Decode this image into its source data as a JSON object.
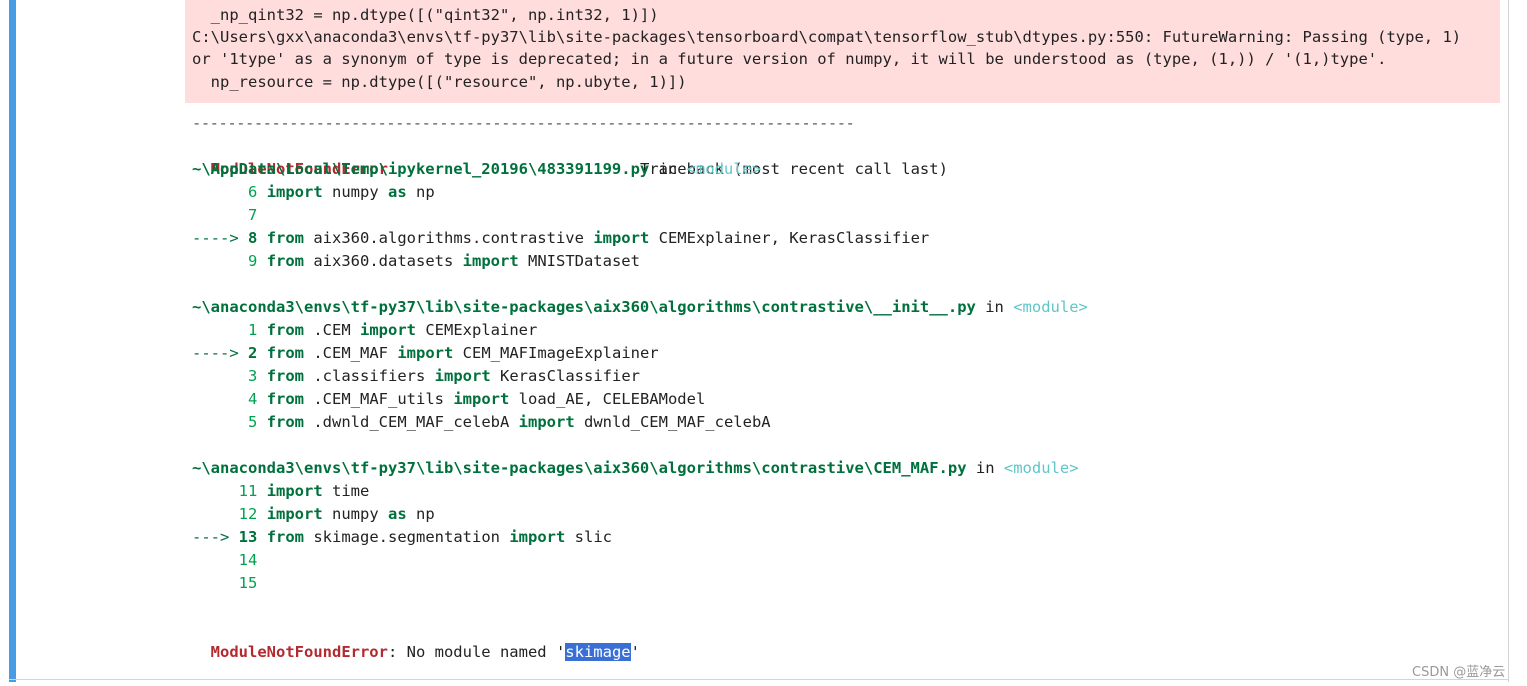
{
  "warning": {
    "lines": [
      "  _np_qint32 = np.dtype([(\"qint32\", np.int32, 1)])",
      "C:\\Users\\gxx\\anaconda3\\envs\\tf-py37\\lib\\site-packages\\tensorboard\\compat\\tensorflow_stub\\dtypes.py:550: FutureWarning: Passing (type, 1)",
      "or '1type' as a synonym of type is deprecated; in a future version of numpy, it will be understood as (type, (1,)) / '(1,)type'.",
      "  np_resource = np.dtype([(\"resource\", np.ubyte, 1)])"
    ]
  },
  "traceback": {
    "separator": "---------------------------------------------------------------------------",
    "error_name": "ModuleNotFoundError",
    "header_gap": "                           ",
    "header_text": "Traceback (most recent call last)",
    "in_text": " in ",
    "module_text": "<module>",
    "frames": [
      {
        "path": "~\\AppData\\Local\\Temp\\ipykernel_20196\\483391199.py",
        "lines": [
          {
            "prefix": "      ",
            "no": "6",
            "code": [
              [
                "kw",
                "import"
              ],
              [
                "plain",
                " numpy "
              ],
              [
                "kw",
                "as"
              ],
              [
                "plain",
                " np"
              ]
            ]
          },
          {
            "prefix": "      ",
            "no": "7",
            "code": []
          },
          {
            "prefix": "----> ",
            "no": "8",
            "current": true,
            "code": [
              [
                "kw",
                "from"
              ],
              [
                "plain",
                " aix360.algorithms.contrastive "
              ],
              [
                "kw",
                "import"
              ],
              [
                "plain",
                " CEMExplainer, KerasClassifier"
              ]
            ]
          },
          {
            "prefix": "      ",
            "no": "9",
            "code": [
              [
                "kw",
                "from"
              ],
              [
                "plain",
                " aix360.datasets "
              ],
              [
                "kw",
                "import"
              ],
              [
                "plain",
                " MNISTDataset"
              ]
            ]
          }
        ]
      },
      {
        "path": "~\\anaconda3\\envs\\tf-py37\\lib\\site-packages\\aix360\\algorithms\\contrastive\\__init__.py",
        "lines": [
          {
            "prefix": "      ",
            "no": "1",
            "code": [
              [
                "kw",
                "from"
              ],
              [
                "plain",
                " .CEM "
              ],
              [
                "kw",
                "import"
              ],
              [
                "plain",
                " CEMExplainer"
              ]
            ]
          },
          {
            "prefix": "----> ",
            "no": "2",
            "current": true,
            "code": [
              [
                "kw",
                "from"
              ],
              [
                "plain",
                " .CEM_MAF "
              ],
              [
                "kw",
                "import"
              ],
              [
                "plain",
                " CEM_MAFImageExplainer"
              ]
            ]
          },
          {
            "prefix": "      ",
            "no": "3",
            "code": [
              [
                "kw",
                "from"
              ],
              [
                "plain",
                " .classifiers "
              ],
              [
                "kw",
                "import"
              ],
              [
                "plain",
                " KerasClassifier"
              ]
            ]
          },
          {
            "prefix": "      ",
            "no": "4",
            "code": [
              [
                "kw",
                "from"
              ],
              [
                "plain",
                " .CEM_MAF_utils "
              ],
              [
                "kw",
                "import"
              ],
              [
                "plain",
                " load_AE, CELEBAModel"
              ]
            ]
          },
          {
            "prefix": "      ",
            "no": "5",
            "code": [
              [
                "kw",
                "from"
              ],
              [
                "plain",
                " .dwnld_CEM_MAF_celebA "
              ],
              [
                "kw",
                "import"
              ],
              [
                "plain",
                " dwnld_CEM_MAF_celebA"
              ]
            ]
          }
        ]
      },
      {
        "path": "~\\anaconda3\\envs\\tf-py37\\lib\\site-packages\\aix360\\algorithms\\contrastive\\CEM_MAF.py",
        "lines": [
          {
            "prefix": "     ",
            "no": "11",
            "code": [
              [
                "kw",
                "import"
              ],
              [
                "plain",
                " time"
              ]
            ]
          },
          {
            "prefix": "     ",
            "no": "12",
            "code": [
              [
                "kw",
                "import"
              ],
              [
                "plain",
                " numpy "
              ],
              [
                "kw",
                "as"
              ],
              [
                "plain",
                " np"
              ]
            ]
          },
          {
            "prefix": "---> ",
            "no": "13",
            "current": true,
            "code": [
              [
                "kw",
                "from"
              ],
              [
                "plain",
                " skimage.segmentation "
              ],
              [
                "kw",
                "import"
              ],
              [
                "plain",
                " slic"
              ]
            ]
          },
          {
            "prefix": "     ",
            "no": "14",
            "code": []
          },
          {
            "prefix": "     ",
            "no": "15",
            "code": []
          }
        ]
      }
    ],
    "final": {
      "error_name": "ModuleNotFoundError",
      "message_before": ": No module named '",
      "selected": "skimage",
      "message_after": "'"
    }
  },
  "watermark": "CSDN @蓝净云"
}
